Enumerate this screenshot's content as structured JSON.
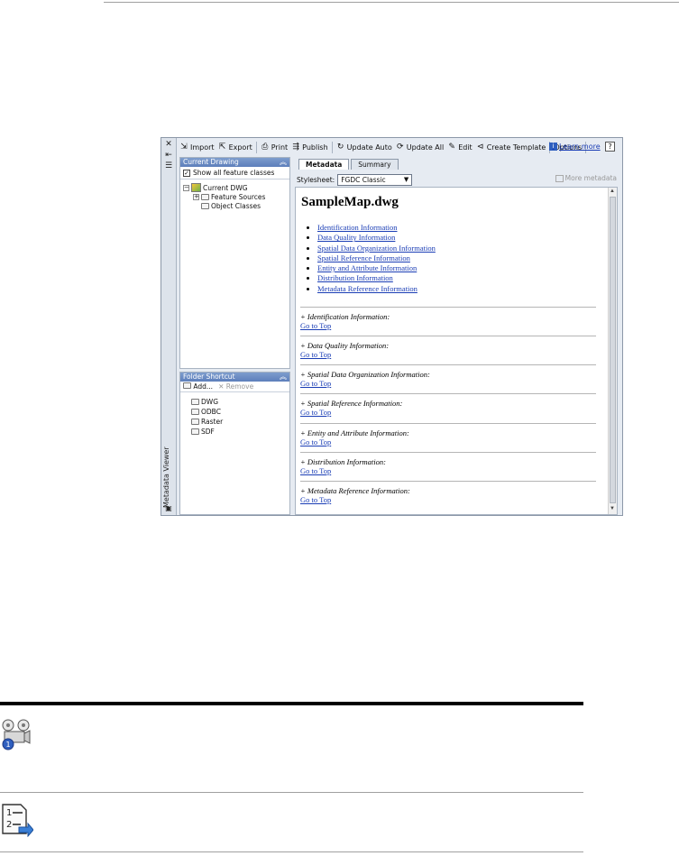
{
  "window": {
    "sidebar_title": "Metadata Viewer",
    "toolbar": {
      "import": "Import",
      "export": "Export",
      "print": "Print",
      "publish": "Publish",
      "update_auto": "Update Auto",
      "update_all": "Update All",
      "edit": "Edit",
      "create_template": "Create Template",
      "options": "Options",
      "learn_more": "Learn more",
      "help": "?"
    },
    "current_drawing": {
      "header": "Current Drawing",
      "show_all": "Show all feature classes",
      "show_all_checked": true,
      "tree": {
        "root": "Current DWG",
        "children": [
          "Feature Sources",
          "Object Classes"
        ]
      }
    },
    "folder_shortcut": {
      "header": "Folder Shortcut",
      "add": "Add...",
      "remove": "Remove",
      "items": [
        "DWG",
        "ODBC",
        "Raster",
        "SDF"
      ]
    },
    "tabs": [
      "Metadata",
      "Summary"
    ],
    "active_tab": "Metadata",
    "stylesheet_label": "Stylesheet:",
    "stylesheet_value": "FGDC Classic",
    "more_metadata": "More metadata",
    "document": {
      "title": "SampleMap.dwg",
      "toc": [
        "Identification Information",
        "Data Quality Information",
        "Spatial Data Organization Information",
        "Spatial Reference Information",
        "Entity and Attribute Information",
        "Distribution Information",
        "Metadata Reference Information"
      ],
      "sections": [
        "+ Identification Information:",
        "+ Data Quality Information:",
        "+ Spatial Data Organization Information:",
        "+ Spatial Reference Information:",
        "+ Entity and Attribute Information:",
        "+ Distribution Information:",
        "+ Metadata Reference Information:"
      ],
      "goto_top": "Go to Top"
    }
  }
}
